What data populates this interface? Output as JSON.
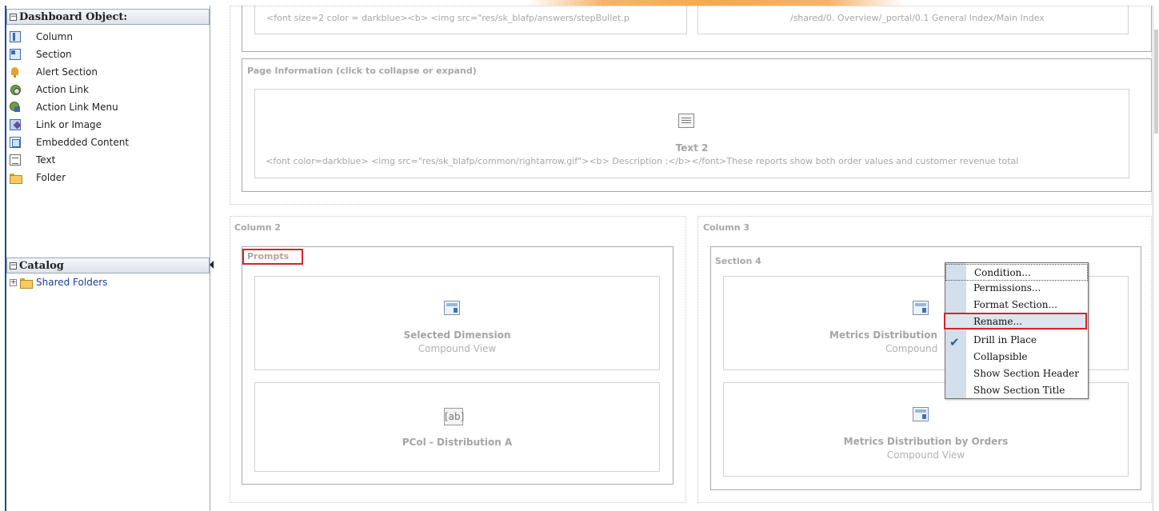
{
  "sidebar": {
    "dashboard_objects_header": "Dashboard Object:",
    "objects": [
      {
        "label": "Column",
        "icon": "column-icon"
      },
      {
        "label": "Section",
        "icon": "section-icon"
      },
      {
        "label": "Alert Section",
        "icon": "alert-section-icon"
      },
      {
        "label": "Action Link",
        "icon": "action-link-icon"
      },
      {
        "label": "Action Link Menu",
        "icon": "action-link-menu-icon"
      },
      {
        "label": "Link or Image",
        "icon": "link-or-image-icon"
      },
      {
        "label": "Embedded Content",
        "icon": "embedded-content-icon"
      },
      {
        "label": "Text",
        "icon": "text-icon"
      },
      {
        "label": "Folder",
        "icon": "folder-icon"
      }
    ],
    "catalog_header": "Catalog",
    "catalog_items": [
      {
        "label": "Shared Folders",
        "icon": "folder-icon"
      }
    ]
  },
  "canvas": {
    "top_left_text": "<font size=2 color = darkblue><b> <img src=\"res/sk_blafp/answers/stepBullet.p",
    "top_right_text": "/shared/0. Overview/_portal/0.1 General Index/Main Index",
    "page_info_section": {
      "title": "Page Information (click to collapse or expand)",
      "view_title": "Text 2",
      "view_text": "<font color=darkblue> <img src=\"res/sk_blafp/common/rightarrow.gif\"><b> Description :</b></font>These reports show both order values and customer revenue total"
    },
    "column2": {
      "label": "Column 2",
      "section_title": "Prompts",
      "views": [
        {
          "title": "Selected Dimension",
          "subtitle": "Compound View"
        },
        {
          "title": "PCol - Distribution A",
          "subtitle": ""
        }
      ]
    },
    "column3": {
      "label": "Column 3",
      "section_title": "Section 4",
      "views": [
        {
          "title": "Metrics Distribution",
          "subtitle": "Compound"
        },
        {
          "title": "Metrics Distribution by Orders",
          "subtitle": "Compound View"
        }
      ]
    }
  },
  "context_menu": {
    "items": [
      {
        "label": "Condition...",
        "checked": false
      },
      {
        "label": "Permissions...",
        "checked": false
      },
      {
        "label": "Format Section...",
        "checked": false
      },
      {
        "label": "Rename...",
        "checked": false
      },
      {
        "label": "Drill in Place",
        "checked": true
      },
      {
        "label": "Collapsible",
        "checked": false
      },
      {
        "label": "Show Section Header",
        "checked": false
      },
      {
        "label": "Show Section Title",
        "checked": false
      }
    ]
  },
  "colors": {
    "highlight": "#d8232a",
    "accent": "#f6a94f",
    "link": "#1a3f9a"
  }
}
